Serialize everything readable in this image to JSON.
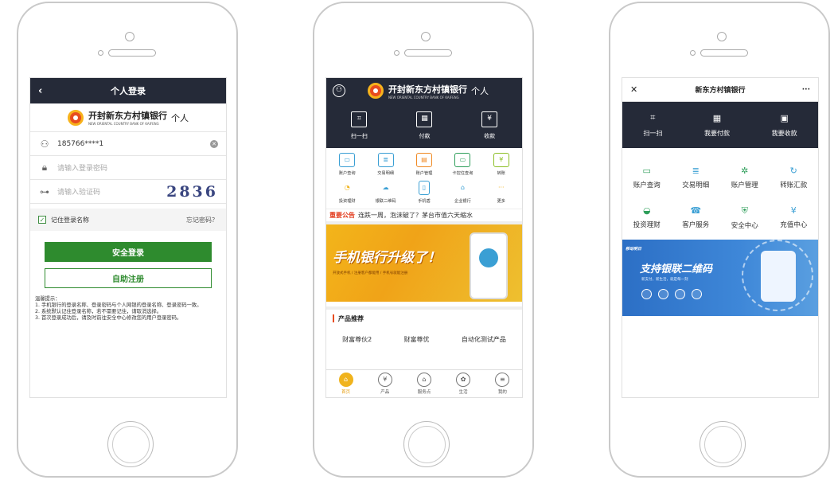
{
  "phone1": {
    "title": "个人登录",
    "back_icon": "chevron-left-icon",
    "bank_name_cn": "开封新东方村镇银行",
    "bank_name_en": "NEW ORIENTAL COUNTRY BANK OF KAIFENG",
    "tag": "个人",
    "username": "185766****1",
    "password_placeholder": "请输入登录密码",
    "captcha_placeholder": "请输入验证码",
    "captcha_code": "2836",
    "remember_label": "记住登录名称",
    "forgot_label": "忘记密码？",
    "login_button": "安全登录",
    "register_button": "自助注册",
    "tips_title": "温馨提示：",
    "tips": [
      "1. 手机银行的登录名称、登录密码与个人网银的登录名称、登录密码一致。",
      "2. 系统默认记住登录名称，若不需要记住，请取消选择。",
      "3. 首次登录成功后，请及时前往安全中心修改您的用户登录密码。"
    ]
  },
  "phone2": {
    "bank_name_cn": "开封新东方村镇银行",
    "bank_name_en": "NEW ORIENTAL COUNTRY BANK OF KAIFENG",
    "tag": "个人",
    "quick": [
      {
        "label": "扫一扫",
        "icon": "scan-icon"
      },
      {
        "label": "付款",
        "icon": "qr-code-icon"
      },
      {
        "label": "收款",
        "icon": "receive-icon"
      }
    ],
    "grid": [
      {
        "label": "账户查询",
        "icon": "account-query-icon",
        "color": "#3a9fd4"
      },
      {
        "label": "交易明细",
        "icon": "transaction-detail-icon",
        "color": "#3a9fd4"
      },
      {
        "label": "账户管理",
        "icon": "account-manage-icon",
        "color": "#f08a24"
      },
      {
        "label": "卡控住查询",
        "icon": "card-query-icon",
        "color": "#2e9e5a"
      },
      {
        "label": "转账",
        "icon": "transfer-icon",
        "color": "#8cbf26"
      },
      {
        "label": "投资理财",
        "icon": "invest-icon",
        "color": "#f0b31d"
      },
      {
        "label": "银联二维码",
        "icon": "unionpay-qr-icon",
        "color": "#3a9fd4"
      },
      {
        "label": "手机盾",
        "icon": "phone-shield-icon",
        "color": "#3a9fd4"
      },
      {
        "label": "企业银行",
        "icon": "enterprise-bank-icon",
        "color": "#3a9fd4"
      },
      {
        "label": "更多",
        "icon": "more-icon",
        "color": "#f0b31d"
      }
    ],
    "notice_tag": "重要公告",
    "notice_text": "连跌一周，泡沫破了？茅台市值六天缩水",
    "banner_title": "手机银行升级了！",
    "banner_sub": "开放式手机 / 注册客户都能用 / 手机号就能注册",
    "section_title": "产品推荐",
    "products": [
      "财富尊伙2",
      "财富尊优",
      "自动化测试产品"
    ],
    "tabs": [
      {
        "label": "首页",
        "icon": "home-icon",
        "active": true
      },
      {
        "label": "产品",
        "icon": "yuan-icon",
        "active": false
      },
      {
        "label": "服务点",
        "icon": "service-point-icon",
        "active": false
      },
      {
        "label": "生活",
        "icon": "life-icon",
        "active": false
      },
      {
        "label": "我的",
        "icon": "profile-icon",
        "active": false
      }
    ]
  },
  "phone3": {
    "title": "新东方村镇银行",
    "close_icon": "close-icon",
    "more_label": "···",
    "quick": [
      {
        "label": "扫一扫",
        "icon": "scan-icon"
      },
      {
        "label": "我要付款",
        "icon": "pay-icon"
      },
      {
        "label": "我要收款",
        "icon": "receive-icon"
      }
    ],
    "grid": [
      {
        "label": "账户查询",
        "icon": "account-query-icon",
        "color": "#2e9e5a"
      },
      {
        "label": "交易明细",
        "icon": "transaction-detail-icon",
        "color": "#3a9fd4"
      },
      {
        "label": "账户管理",
        "icon": "account-manage-icon",
        "color": "#2e9e5a"
      },
      {
        "label": "转账汇款",
        "icon": "transfer-icon",
        "color": "#3a9fd4"
      },
      {
        "label": "投资理财",
        "icon": "invest-icon",
        "color": "#2e9e5a"
      },
      {
        "label": "客户服务",
        "icon": "customer-service-icon",
        "color": "#3a9fd4"
      },
      {
        "label": "安全中心",
        "icon": "security-icon",
        "color": "#2e9e5a"
      },
      {
        "label": "充值中心",
        "icon": "recharge-icon",
        "color": "#3a9fd4"
      }
    ],
    "banner_badge": "移动明日",
    "banner_title": "支持银联二维码",
    "banner_sub": "新支付，新生活，就是每一刻"
  }
}
